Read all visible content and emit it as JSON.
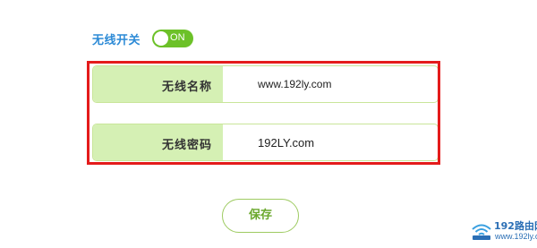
{
  "wireless_switch": {
    "label": "无线开关",
    "state_text": "ON",
    "enabled": true
  },
  "fields": {
    "ssid": {
      "label": "无线名称",
      "value": "www.192ly.com"
    },
    "password": {
      "label": "无线密码",
      "value": "192LY.com"
    }
  },
  "actions": {
    "save_label": "保存"
  },
  "watermark": {
    "brand": "192路由网",
    "url": "www.192ly.com",
    "icon": "wifi-signal-icon"
  },
  "colors": {
    "accent_green": "#6cc128",
    "label_bg": "#d5f0b4",
    "switch_label_blue": "#2c8ad6",
    "highlight_red": "#e41b1b"
  }
}
